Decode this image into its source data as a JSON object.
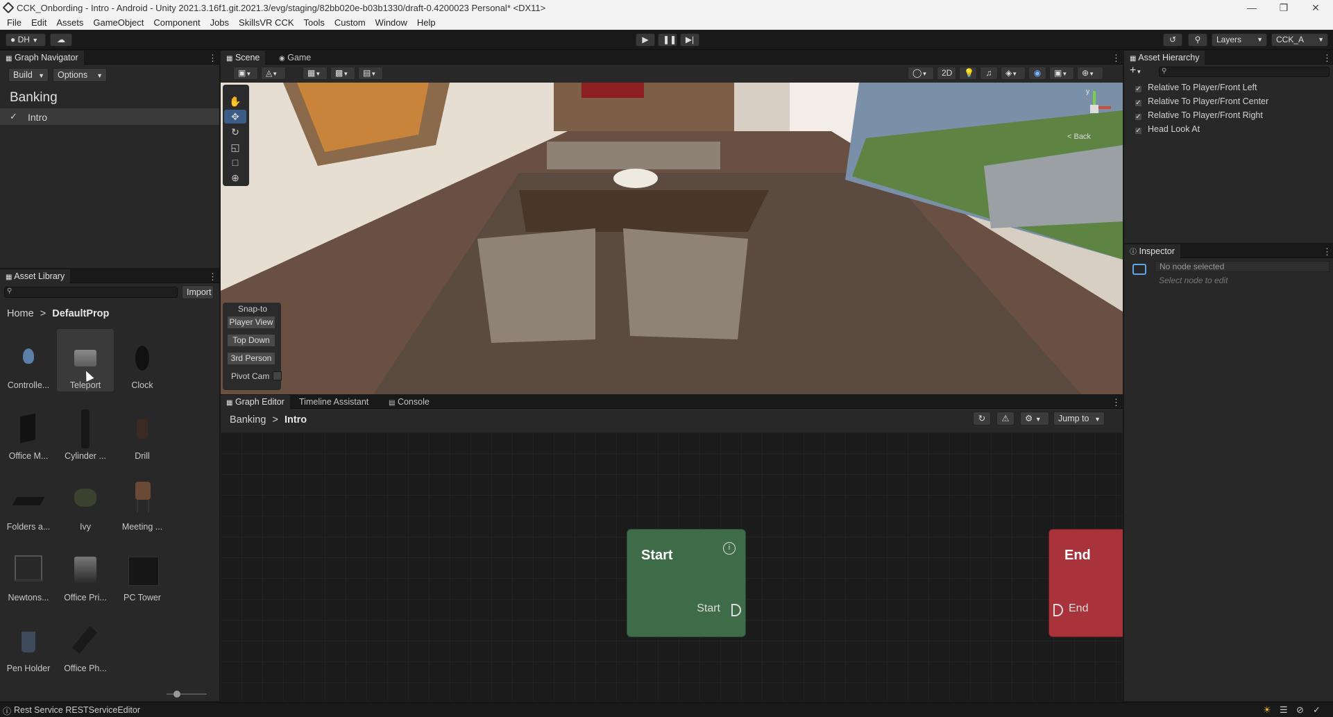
{
  "window": {
    "title": "CCK_Onbording - Intro - Android - Unity 2021.3.16f1.git.2021.3/evg/staging/82bb020e-b03b1330/draft-0.4200023 Personal* <DX11>"
  },
  "menu": [
    "File",
    "Edit",
    "Assets",
    "GameObject",
    "Component",
    "Jobs",
    "SkillsVR CCK",
    "Tools",
    "Custom",
    "Window",
    "Help"
  ],
  "toolbar": {
    "account": "DH",
    "layers": "Layers",
    "layout": "CCK_A"
  },
  "graph_navigator": {
    "tab": "Graph Navigator",
    "build": "Build",
    "options": "Options",
    "project": "Banking",
    "items": [
      {
        "label": "Intro",
        "checked": true
      }
    ]
  },
  "asset_library": {
    "tab": "Asset Library",
    "search_placeholder": "",
    "import": "Import",
    "breadcrumb_home": "Home",
    "breadcrumb_current": "DefaultProp",
    "items": [
      "Controlle...",
      "Teleport",
      "Clock",
      "Office M...",
      "Cylinder ...",
      "Drill",
      "Folders a...",
      "Ivy",
      "Meeting ...",
      "Newtons...",
      "Office Pri...",
      "PC Tower",
      "Pen Holder",
      "Office Ph..."
    ]
  },
  "scene": {
    "tabs": [
      "Scene",
      "Game"
    ],
    "mode_2d": "2D",
    "back_label": "< Back",
    "gizmo_y": "y",
    "snap_title": "Snap-to",
    "snap_buttons": [
      "Player View",
      "Top Down",
      "3rd Person"
    ],
    "pivot_cam": "Pivot Cam"
  },
  "graph_editor": {
    "tabs": [
      "Graph Editor",
      "Timeline Assistant",
      "Console"
    ],
    "breadcrumb_root": "Banking",
    "breadcrumb_current": "Intro",
    "jump_to": "Jump to",
    "start_node": {
      "title": "Start",
      "port": "Start",
      "color": "#3e6b48"
    },
    "end_node": {
      "title": "End",
      "port": "End",
      "color": "#a8333a"
    }
  },
  "asset_hierarchy": {
    "tab": "Asset Hierarchy",
    "items": [
      "Relative To Player/Front Left",
      "Relative To Player/Front Center",
      "Relative To Player/Front Right",
      "Head Look At"
    ]
  },
  "inspector": {
    "tab": "Inspector",
    "no_node": "No node selected",
    "hint": "Select node to edit"
  },
  "status": {
    "text": "Rest Service RESTServiceEditor"
  },
  "colors": {
    "accent": "#3a79bb",
    "panel": "#282828",
    "graph_bg": "#1b1b1b"
  }
}
